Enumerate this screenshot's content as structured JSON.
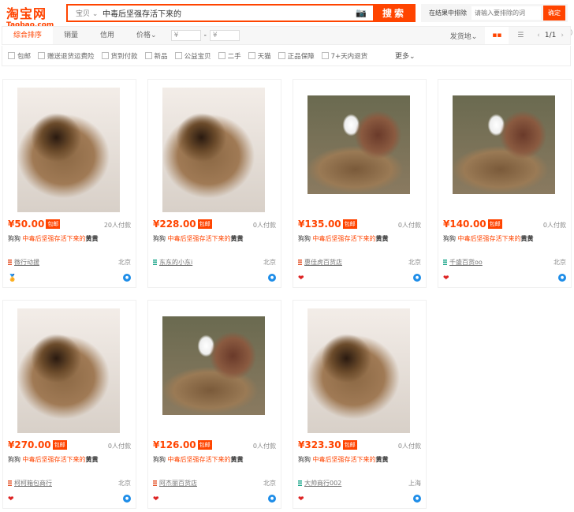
{
  "header": {
    "logo_cn": "淘宝网",
    "logo_en": "Taobao.com",
    "category": "宝贝 ⌄",
    "query": "中毒后坚强存活下来的",
    "search_btn": "搜索",
    "exclude_label": "在结果中排除",
    "exclude_placeholder": "请输入要排除的词",
    "confirm": "确定"
  },
  "sort": {
    "items": [
      "综合排序",
      "销量",
      "信用",
      "价格⌄"
    ],
    "price_from": "¥",
    "price_sep": "-",
    "price_to": "¥",
    "ship_from": "发货地⌄",
    "pager": "1/1",
    "prev": "‹",
    "next": "›"
  },
  "filters": [
    "包邮",
    "赠送退货运费险",
    "货到付款",
    "新品",
    "公益宝贝",
    "二手",
    "天猫",
    "正品保障",
    "7+天内退货"
  ],
  "more": "更多⌄",
  "products": [
    {
      "price": "¥50.00",
      "tag": "包邮",
      "sold": "20人付款",
      "pre": "狗狗 ",
      "hl": "中毒后坚强存活下来的",
      "post": "黄黄",
      "shop": "微行动援",
      "loc": "北京",
      "img": "dog",
      "shopColor": "red",
      "badge": "🏅"
    },
    {
      "price": "¥228.00",
      "tag": "包邮",
      "sold": "0人付款",
      "pre": "狗狗 ",
      "hl": "中毒后坚强存活下来的",
      "post": "黄黄",
      "shop": "东东的小东i",
      "loc": "北京",
      "img": "dog",
      "shopColor": "green",
      "badge": ""
    },
    {
      "price": "¥135.00",
      "tag": "包邮",
      "sold": "0人付款",
      "pre": "狗狗 ",
      "hl": "中毒后坚强存活下来的",
      "post": "黄黄",
      "shop": "惠佳虎百货店",
      "loc": "北京",
      "img": "yard",
      "shopColor": "red",
      "badge": "❤"
    },
    {
      "price": "¥140.00",
      "tag": "包邮",
      "sold": "0人付款",
      "pre": "狗狗 ",
      "hl": "中毒后坚强存活下来的",
      "post": "黄黄",
      "shop": "千盛百货oo",
      "loc": "北京",
      "img": "yard",
      "shopColor": "green",
      "badge": "❤"
    },
    {
      "price": "¥270.00",
      "tag": "包邮",
      "sold": "0人付款",
      "pre": "狗狗 ",
      "hl": "中毒后坚强存活下来的",
      "post": "黄黄",
      "shop": "柯柯箱包商行",
      "loc": "北京",
      "img": "dog",
      "shopColor": "red",
      "badge": "❤"
    },
    {
      "price": "¥126.00",
      "tag": "包邮",
      "sold": "0人付款",
      "pre": "狗狗 ",
      "hl": "中毒后坚强存活下来的",
      "post": "黄黄",
      "shop": "阿杰丽百货店",
      "loc": "北京",
      "img": "yard",
      "shopColor": "red",
      "badge": "❤"
    },
    {
      "price": "¥323.30",
      "tag": "包邮",
      "sold": "0人付款",
      "pre": "狗狗 ",
      "hl": "中毒后坚强存活下来的",
      "post": "黄黄",
      "shop": "大帅商行002",
      "loc": "上海",
      "img": "dog",
      "shopColor": "green",
      "badge": "❤"
    }
  ]
}
